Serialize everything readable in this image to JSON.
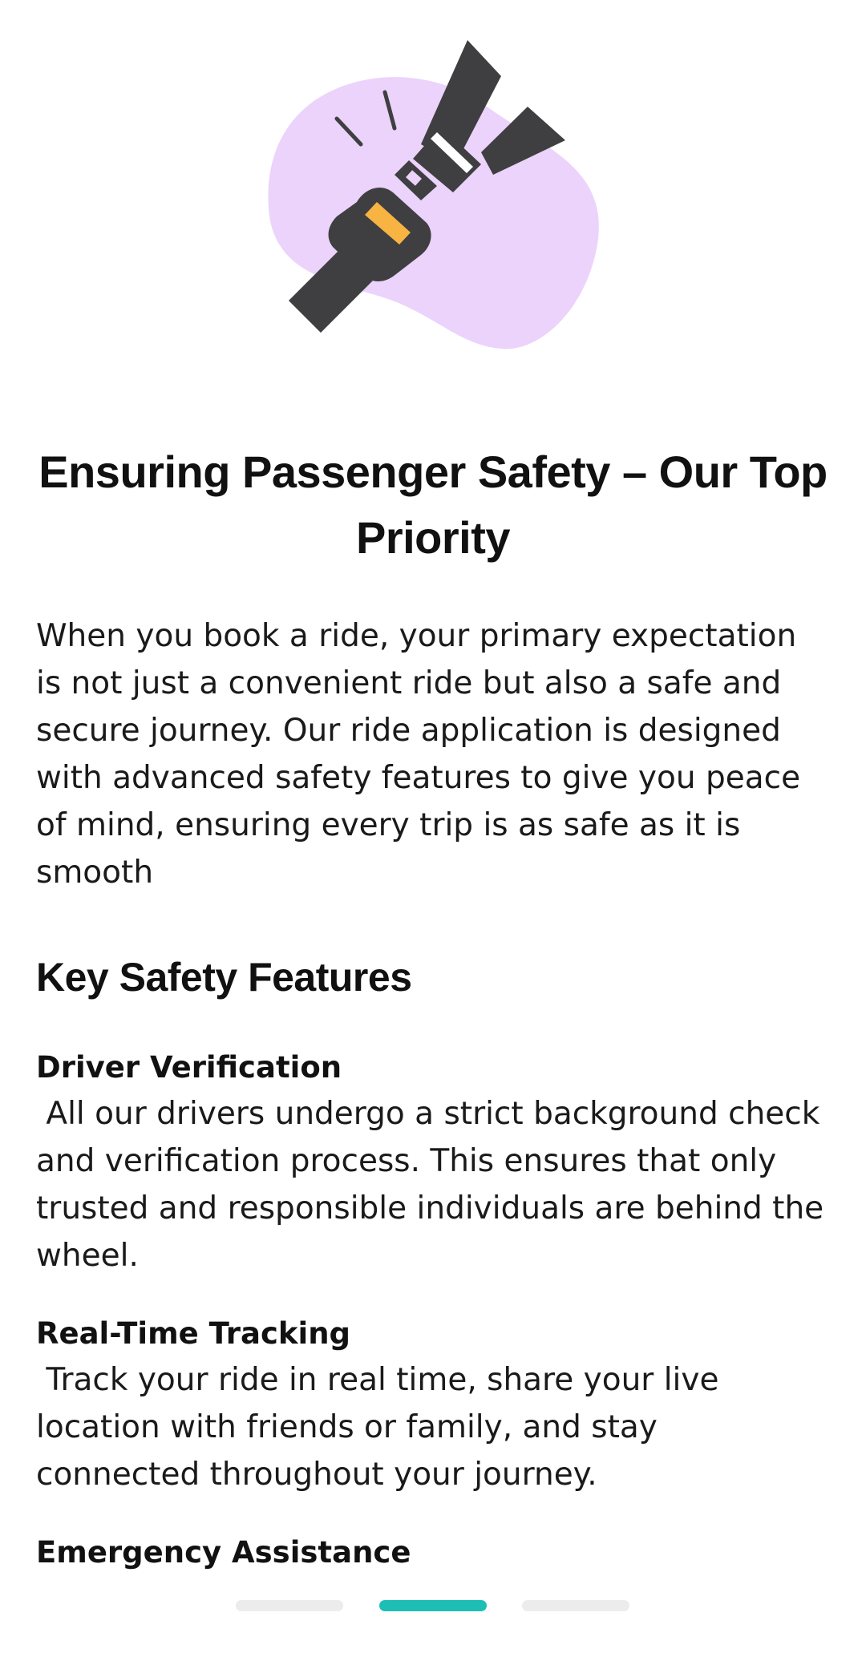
{
  "illustration": {
    "icon": "seatbelt-icon",
    "blob_color": "#ebd3fb",
    "belt_color": "#3f3f41",
    "accent_color": "#f7b443"
  },
  "page": {
    "title": "Ensuring Passenger Safety – Our Top Priority",
    "intro": "When you book a ride, your primary expectation is not just a convenient ride but also a safe and secure journey. Our ride application is designed with advanced safety features to give you peace of mind, ensuring every trip is as safe as it is smooth"
  },
  "features": {
    "heading": "Key Safety Features",
    "items": [
      {
        "title": "Driver Verification",
        "description": " All our drivers undergo a strict background check and verification process. This ensures that only trusted and responsible individuals are behind the wheel."
      },
      {
        "title": "Real-Time Tracking",
        "description": " Track your ride in real time, share your live location with friends or family, and stay connected throughout your journey."
      },
      {
        "title": "Emergency Assistance",
        "description": ""
      }
    ]
  },
  "pager": {
    "total_pages": 3,
    "active_page": 2,
    "active_color": "#1dbfb4",
    "inactive_color": "#ececec"
  }
}
